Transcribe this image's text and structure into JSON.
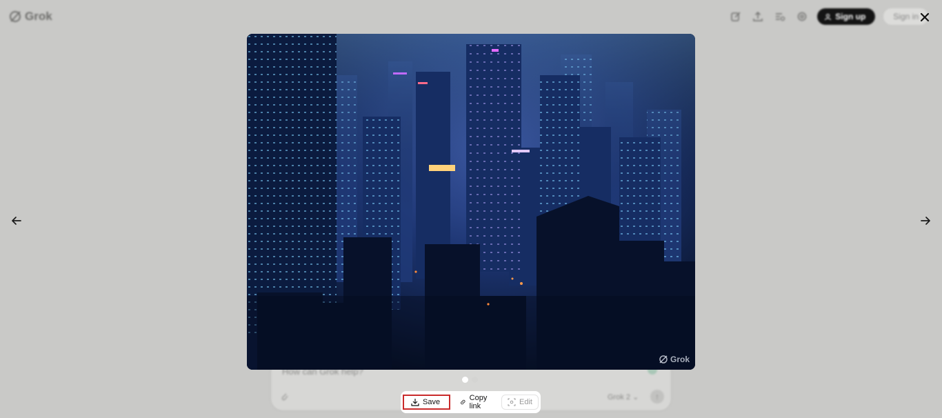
{
  "app": {
    "logo_text": "Grok"
  },
  "header": {
    "icons": [
      "new-chat-icon",
      "share-icon",
      "history-icon",
      "settings-icon"
    ],
    "signup_label": "Sign up",
    "signin_label": "Sign in"
  },
  "composer": {
    "placeholder": "How can Grok help?",
    "model_label": "Grok 2 ⌄"
  },
  "lightbox": {
    "watermark_text": "Grok",
    "pagination": {
      "count": 2,
      "current": 1
    },
    "toolbar": {
      "save_label": "Save",
      "copy_link_label": "Copy link",
      "edit_label": "Edit"
    }
  },
  "colors": {
    "accent_highlight": "#c92a2a",
    "signup_bg": "#141414"
  }
}
